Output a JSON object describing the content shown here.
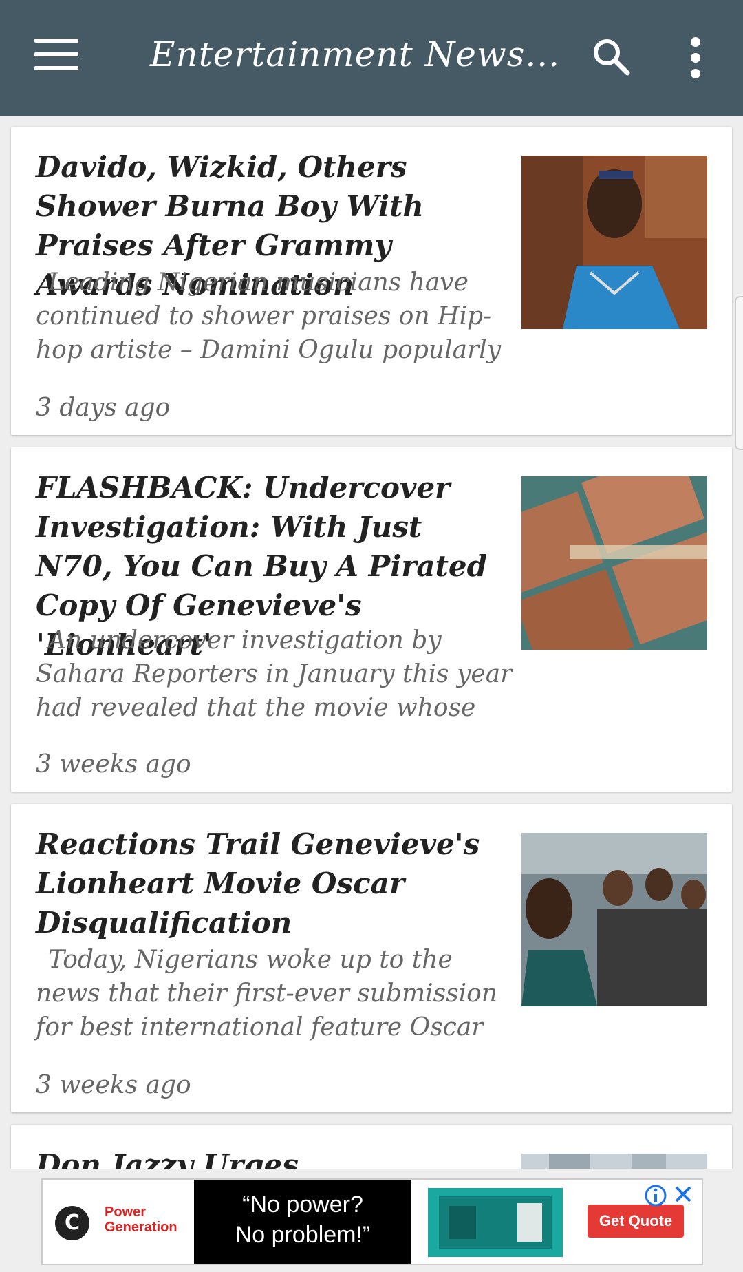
{
  "appbar": {
    "title": "Entertainment News..."
  },
  "articles": [
    {
      "headline": "Davido, Wizkid, Others Shower Burna Boy With Praises After Grammy Awards Nomination",
      "excerpt": "Leading Nigerian musicians have continued to shower praises on Hip-hop artiste – Damini Ogulu popularly",
      "time": "3 days ago"
    },
    {
      "headline": "FLASHBACK: Undercover Investigation: With Just N70, You Can Buy A Pirated Copy Of Genevieve's 'Lionheart'",
      "excerpt": "An undercover investigation by Sahara Reporters in January this year had revealed that the movie whose",
      "time": "3 weeks ago"
    },
    {
      "headline": "Reactions Trail Genevieve's Lionheart Movie Oscar Disqualification",
      "excerpt": "Today, Nigerians woke up to the news that their first-ever submission for best international feature Oscar",
      "time": "3 weeks ago"
    },
    {
      "headline": "Don Jazzy Urges Government"
    }
  ],
  "ad": {
    "logo_letter": "C",
    "brand_line1": "Power",
    "brand_line2": "Generation",
    "quote_line1": "“No power?",
    "quote_line2": "No problem!”",
    "cta": "Get Quote",
    "accent": "#e53935"
  },
  "colors": {
    "appbar": "#455a64",
    "background": "#eeeeee"
  }
}
